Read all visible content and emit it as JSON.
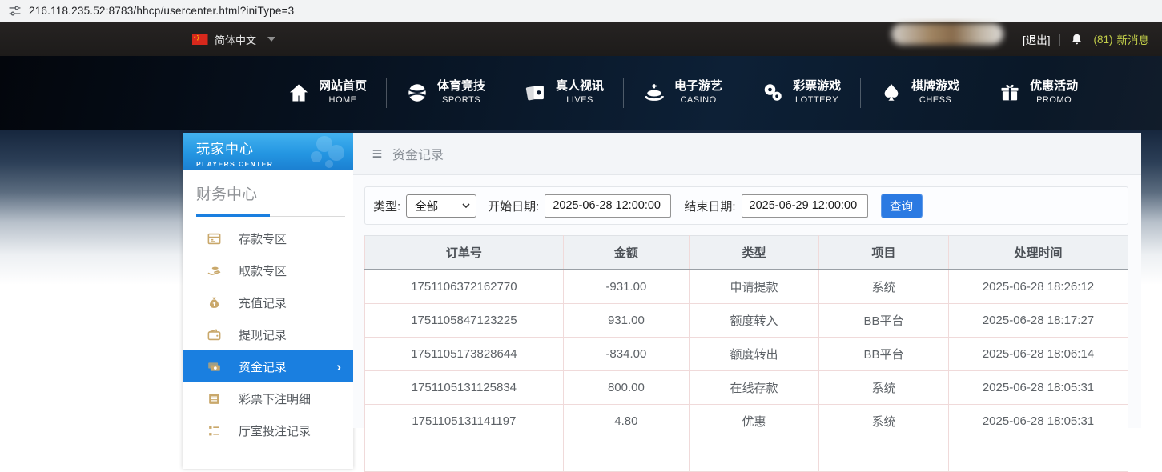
{
  "browser": {
    "url": "216.118.235.52:8783/hhcp/usercenter.html?iniType=3"
  },
  "topbar": {
    "language_label": "简体中文",
    "logout_label": "[退出]",
    "message_count": "(81)",
    "message_label": "新消息"
  },
  "nav": {
    "items": [
      {
        "zh": "网站首页",
        "en": "HOME",
        "icon": "home"
      },
      {
        "zh": "体育竞技",
        "en": "SPORTS",
        "icon": "sports-ball"
      },
      {
        "zh": "真人视讯",
        "en": "LIVES",
        "icon": "cards"
      },
      {
        "zh": "电子游艺",
        "en": "CASINO",
        "icon": "roulette"
      },
      {
        "zh": "彩票游戏",
        "en": "LOTTERY",
        "icon": "lottery-balls"
      },
      {
        "zh": "棋牌游戏",
        "en": "CHESS",
        "icon": "spade"
      },
      {
        "zh": "优惠活动",
        "en": "PROMO",
        "icon": "gift"
      }
    ]
  },
  "sidebar": {
    "title_zh": "玩家中心",
    "title_en": "PLAYERS CENTER",
    "section_title": "财务中心",
    "items": [
      {
        "label": "存款专区",
        "icon": "deposit-card",
        "active": false
      },
      {
        "label": "取款专区",
        "icon": "withdraw-hand",
        "active": false
      },
      {
        "label": "充值记录",
        "icon": "money-bag",
        "active": false
      },
      {
        "label": "提现记录",
        "icon": "wallet",
        "active": false
      },
      {
        "label": "资金记录",
        "icon": "banknotes",
        "active": true
      },
      {
        "label": "彩票下注明细",
        "icon": "document",
        "active": false
      },
      {
        "label": "厅室投注记录",
        "icon": "list",
        "active": false
      }
    ]
  },
  "main": {
    "breadcrumb": "资金记录",
    "filters": {
      "type_label": "类型:",
      "type_value": "全部",
      "start_label": "开始日期:",
      "start_value": "2025-06-28 12:00:00",
      "end_label": "结束日期:",
      "end_value": "2025-06-29 12:00:00",
      "search_label": "查询"
    },
    "table": {
      "headers": [
        "订单号",
        "金额",
        "类型",
        "项目",
        "处理时间"
      ],
      "rows": [
        [
          "1751106372162770",
          "-931.00",
          "申请提款",
          "系统",
          "2025-06-28 18:26:12"
        ],
        [
          "1751105847123225",
          "931.00",
          "额度转入",
          "BB平台",
          "2025-06-28 18:17:27"
        ],
        [
          "1751105173828644",
          "-834.00",
          "额度转出",
          "BB平台",
          "2025-06-28 18:06:14"
        ],
        [
          "1751105131125834",
          "800.00",
          "在线存款",
          "系统",
          "2025-06-28 18:05:31"
        ],
        [
          "1751105131141197",
          "4.80",
          "优惠",
          "系统",
          "2025-06-28 18:05:31"
        ]
      ]
    }
  },
  "colors": {
    "accent_blue": "#2b7ae2",
    "active_item_blue": "#1a7fe0",
    "sidebar_header_blue": "#2496e2",
    "gold_icon": "#c9a86b",
    "message_yellow": "#c3cf4a",
    "table_border_pink": "#f0dada"
  }
}
